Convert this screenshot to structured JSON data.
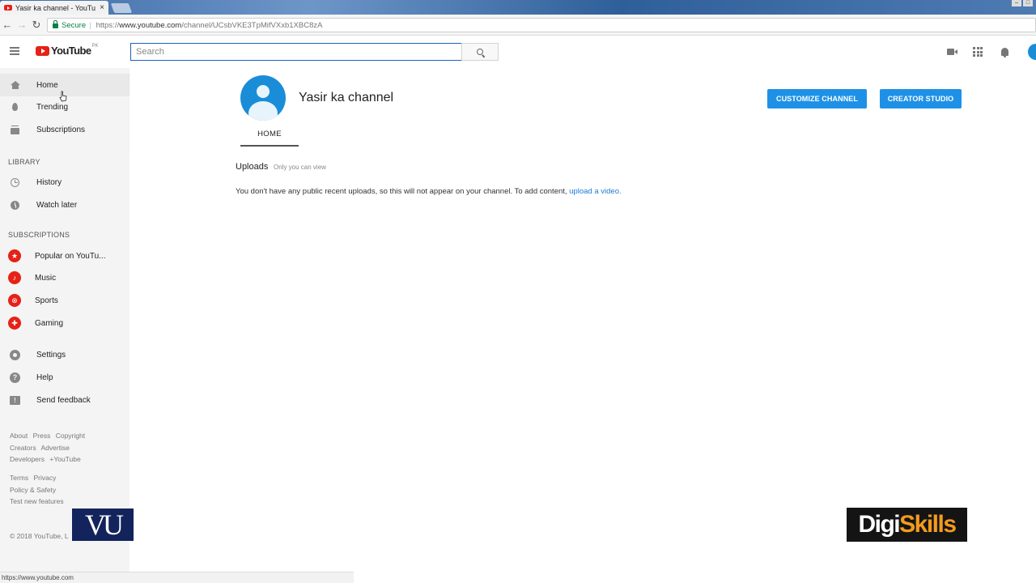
{
  "browser": {
    "tab_title": "Yasir ka channel - YouTu",
    "close_glyph": "×",
    "secure_label": "Secure",
    "url_prefix": "https://",
    "url_host": "www.youtube.com",
    "url_path": "/channel/UCsbVKE3TpMifVXxb1XBC8zA",
    "status_url": "https://www.youtube.com"
  },
  "masthead": {
    "logo_text": "YouTube",
    "country": "PK",
    "search_placeholder": "Search"
  },
  "sidebar": {
    "main": [
      {
        "label": "Home",
        "icon": "home-icon"
      },
      {
        "label": "Trending",
        "icon": "flame-icon"
      },
      {
        "label": "Subscriptions",
        "icon": "subscriptions-icon"
      }
    ],
    "library_heading": "LIBRARY",
    "library": [
      {
        "label": "History",
        "icon": "history-icon"
      },
      {
        "label": "Watch later",
        "icon": "clock-icon"
      }
    ],
    "subscriptions_heading": "SUBSCRIPTIONS",
    "subscriptions": [
      {
        "label": "Popular on YouTu...",
        "icon": "star-icon"
      },
      {
        "label": "Music",
        "icon": "music-note-icon"
      },
      {
        "label": "Sports",
        "icon": "sports-ball-icon"
      },
      {
        "label": "Gaming",
        "icon": "gamepad-icon"
      }
    ],
    "misc": [
      {
        "label": "Settings",
        "icon": "gear-icon"
      },
      {
        "label": "Help",
        "icon": "help-icon"
      },
      {
        "label": "Send feedback",
        "icon": "feedback-icon"
      }
    ],
    "footer": {
      "row1": [
        "About",
        "Press",
        "Copyright"
      ],
      "row2": [
        "Creators",
        "Advertise"
      ],
      "row3": [
        "Developers",
        "+YouTube"
      ],
      "row4": [
        "Terms",
        "Privacy"
      ],
      "row5": [
        "Policy & Safety"
      ],
      "row6": [
        "Test new features"
      ],
      "copyright": "© 2018 YouTube, L"
    }
  },
  "channel": {
    "name": "Yasir ka channel",
    "tab_home": "HOME",
    "customize_label": "CUSTOMIZE CHANNEL",
    "studio_label": "CREATOR STUDIO",
    "uploads_title": "Uploads",
    "uploads_note": "Only you can view",
    "no_uploads_text": "You don't have any public recent uploads, so this will not appear on your channel. To add content, ",
    "upload_link": "upload a video."
  },
  "overlays": {
    "vu_logo": "VU",
    "digi_part1": "Digi",
    "digi_part2": "Skills"
  },
  "colors": {
    "accent_blue": "#1e91e7",
    "youtube_red": "#e62117",
    "avatar_blue": "#1a8dd8",
    "digiskills_orange": "#f39a1e"
  }
}
